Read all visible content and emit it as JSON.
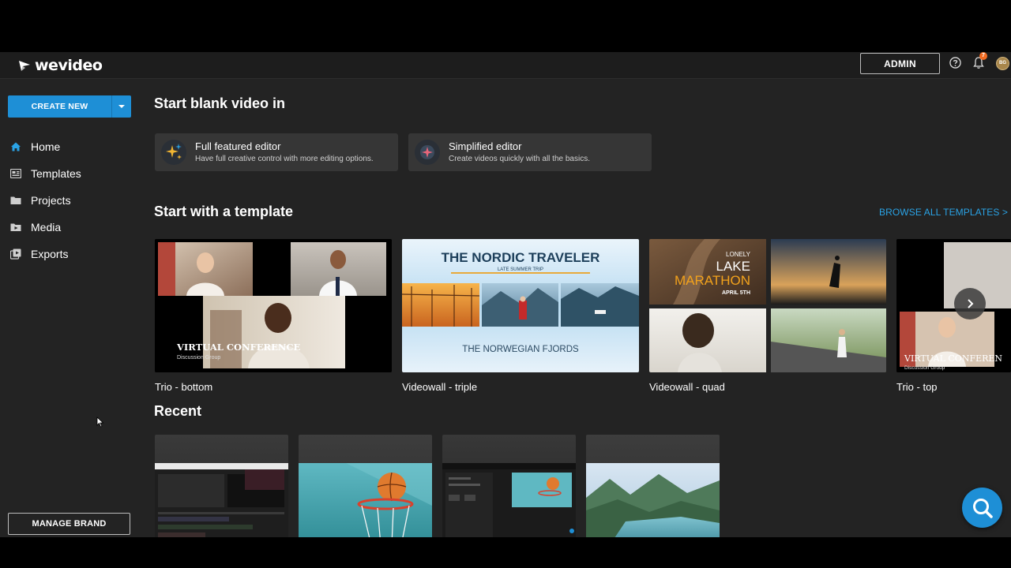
{
  "app": {
    "logo_text": "wevideo"
  },
  "topbar": {
    "admin_label": "ADMIN",
    "notification_count": "7",
    "avatar_initials": "BG"
  },
  "sidebar": {
    "create_new_label": "CREATE NEW",
    "items": [
      {
        "label": "Home",
        "icon": "home-icon"
      },
      {
        "label": "Templates",
        "icon": "templates-icon"
      },
      {
        "label": "Projects",
        "icon": "folder-icon"
      },
      {
        "label": "Media",
        "icon": "media-folder-icon"
      },
      {
        "label": "Exports",
        "icon": "exports-icon"
      }
    ],
    "manage_brand_label": "MANAGE BRAND"
  },
  "main": {
    "blank_heading": "Start blank video in",
    "editors": [
      {
        "title": "Full featured editor",
        "desc": "Have full creative control with more editing options."
      },
      {
        "title": "Simplified editor",
        "desc": "Create videos quickly with all the basics."
      }
    ],
    "template_heading": "Start with a template",
    "browse_all_label": "BROWSE ALL TEMPLATES >",
    "templates": [
      {
        "label": "Trio - bottom",
        "overlay": "VIRTUAL CONFERENCE",
        "sub": "Discussion Group"
      },
      {
        "label": "Videowall - triple",
        "overlay": "THE NORDIC TRAVELER",
        "sub": "LATE SUMMER TRIP",
        "footer": "THE NORWEGIAN FJORDS"
      },
      {
        "label": "Videowall - quad",
        "overlay_small": "LONELY",
        "overlay_mid": "LAKE",
        "overlay_big": "MARATHON",
        "overlay_date": "APRIL 5TH"
      },
      {
        "label": "Trio - top",
        "overlay": "VIRTUAL CONFEREN",
        "sub": "Discussion Group"
      }
    ],
    "recent_heading": "Recent"
  },
  "colors": {
    "accent": "#1e8fd6",
    "link": "#2aa3e6",
    "badge": "#f26b21"
  }
}
